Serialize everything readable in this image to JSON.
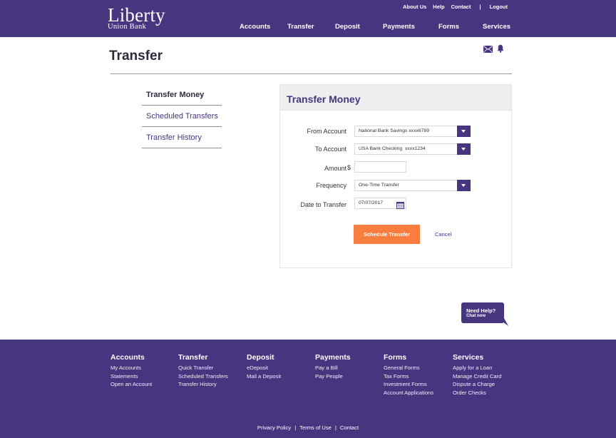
{
  "brand": {
    "name": "Liberty",
    "sub": "Union Bank"
  },
  "header": {
    "top_links": [
      "About Us",
      "Help",
      "Contact",
      "|",
      "Logout"
    ],
    "nav": [
      "Accounts",
      "Transfer",
      "Deposit",
      "Payments",
      "Forms",
      "Services"
    ]
  },
  "page": {
    "title": "Transfer",
    "icons": [
      "mail-icon",
      "bell-icon"
    ]
  },
  "sidebar": {
    "items": [
      {
        "label": "Transfer Money",
        "active": true
      },
      {
        "label": "Scheduled Transfers",
        "active": false
      },
      {
        "label": "Transfer History",
        "active": false
      }
    ]
  },
  "form": {
    "title": "Transfer Money",
    "from_account": {
      "label": "From Account",
      "value": "National Bank Savings xxxx6789"
    },
    "to_account": {
      "label": "To Account",
      "value": "USA Bank Checking  xxxx1234"
    },
    "amount": {
      "label": "Amount",
      "currency": "$",
      "value": ""
    },
    "frequency": {
      "label": "Frequency",
      "value": "One-Time Transfer"
    },
    "date": {
      "label": "Date to Transfer",
      "value": "07/07/2017"
    },
    "submit_label": "Schedule Transfer",
    "cancel_label": "Cancel"
  },
  "help": {
    "line1": "Need Help?",
    "line2": "Chat now"
  },
  "footer": {
    "columns": [
      {
        "heading": "Accounts",
        "links": [
          "My Accounts",
          "Statements",
          "Open an Account"
        ]
      },
      {
        "heading": "Transfer",
        "links": [
          "Quick Transfer",
          "Scheduled Transfers",
          "Transfer History"
        ]
      },
      {
        "heading": "Deposit",
        "links": [
          "eDeposit",
          "Mail a Deposit"
        ]
      },
      {
        "heading": "Payments",
        "links": [
          "Pay a Bill",
          "Pay People"
        ]
      },
      {
        "heading": "Forms",
        "links": [
          "General Forms",
          "Tax Forms",
          "Investment Forms",
          "Account Applications"
        ]
      },
      {
        "heading": "Services",
        "links": [
          "Apply for a Loan",
          "Manage Credit Card",
          "Dispute a Charge",
          "Order Checks"
        ]
      }
    ],
    "legal": [
      "Privacy Policy",
      "Terms of Use",
      "Contact"
    ]
  },
  "colors": {
    "brand_purple": "#47357f",
    "accent_orange": "#f97d3e"
  }
}
